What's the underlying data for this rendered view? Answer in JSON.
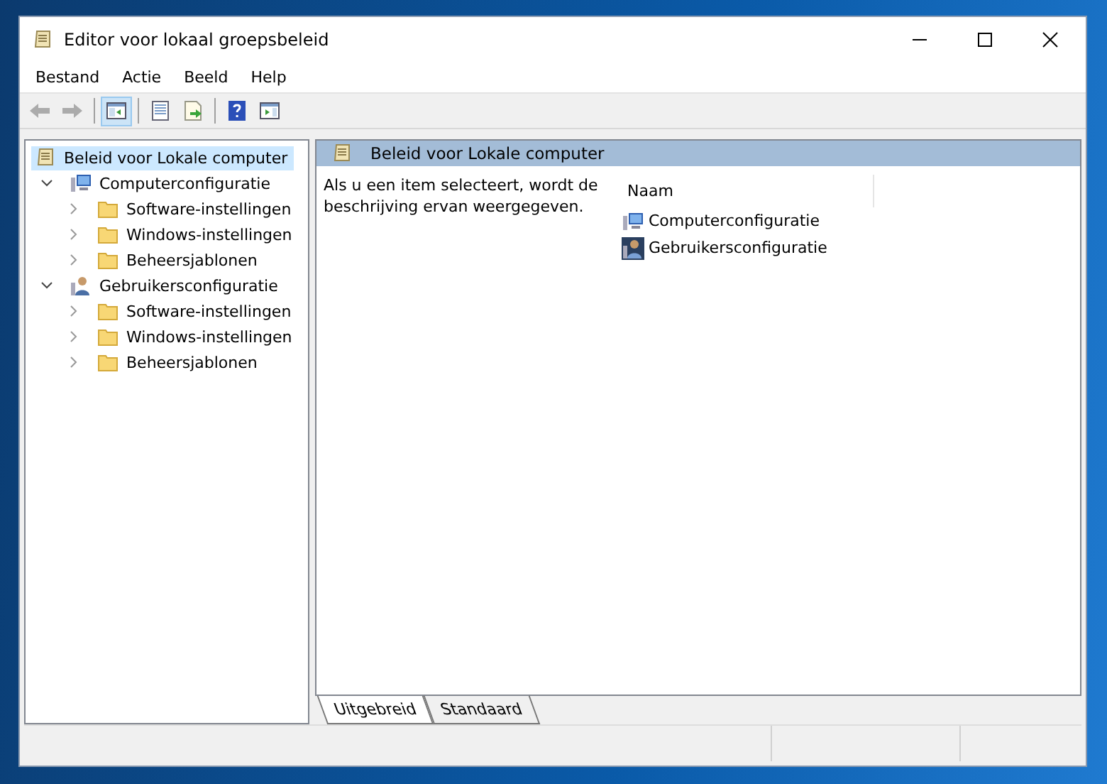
{
  "window": {
    "title": "Editor voor lokaal groepsbeleid"
  },
  "menu": [
    "Bestand",
    "Actie",
    "Beeld",
    "Help"
  ],
  "toolbar": [
    {
      "kind": "back",
      "disabled": true,
      "selected": false
    },
    {
      "kind": "forward",
      "disabled": true,
      "selected": false
    },
    {
      "kind": "separator"
    },
    {
      "kind": "tree",
      "disabled": false,
      "selected": true
    },
    {
      "kind": "separator"
    },
    {
      "kind": "list",
      "disabled": false,
      "selected": false
    },
    {
      "kind": "export",
      "disabled": false,
      "selected": false
    },
    {
      "kind": "separator"
    },
    {
      "kind": "help",
      "disabled": false,
      "selected": false
    },
    {
      "kind": "pane",
      "disabled": false,
      "selected": false
    }
  ],
  "tree": [
    {
      "label": "Beleid voor Lokale computer",
      "kind": "policy",
      "selected": true,
      "children": [
        {
          "label": "Computerconfiguratie",
          "kind": "computer",
          "selected": false,
          "expanded": true,
          "children": [
            {
              "label": "Software-instellingen",
              "kind": "folder",
              "selected": false,
              "expanded": false
            },
            {
              "label": "Windows-instellingen",
              "kind": "folder",
              "selected": false,
              "expanded": false
            },
            {
              "label": "Beheersjablonen",
              "kind": "folder",
              "selected": false,
              "expanded": false
            }
          ]
        },
        {
          "label": "Gebruikersconfiguratie",
          "kind": "user",
          "selected": false,
          "expanded": true,
          "children": [
            {
              "label": "Software-instellingen",
              "kind": "folder",
              "selected": false,
              "expanded": false
            },
            {
              "label": "Windows-instellingen",
              "kind": "folder",
              "selected": false,
              "expanded": false
            },
            {
              "label": "Beheersjablonen",
              "kind": "folder",
              "selected": false,
              "expanded": false
            }
          ]
        }
      ]
    }
  ],
  "details": {
    "header": "Beleid voor Lokale computer",
    "description": "Als u een item selecteert, wordt de beschrijving ervan weergegeven.",
    "column": "Naam",
    "items": [
      {
        "label": "Computerconfiguratie",
        "kind": "computer"
      },
      {
        "label": "Gebruikersconfiguratie",
        "kind": "user"
      }
    ]
  },
  "tabs": [
    {
      "label": "Uitgebreid",
      "selected": true
    },
    {
      "label": "Standaard",
      "selected": false
    }
  ]
}
